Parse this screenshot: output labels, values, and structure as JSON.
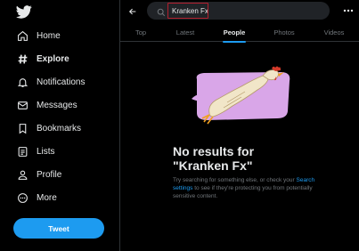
{
  "sidebar": {
    "logo": "bird-icon",
    "items": [
      {
        "label": "Home",
        "icon": "home-icon"
      },
      {
        "label": "Explore",
        "icon": "hashtag-icon",
        "active": true
      },
      {
        "label": "Notifications",
        "icon": "bell-icon"
      },
      {
        "label": "Messages",
        "icon": "envelope-icon"
      },
      {
        "label": "Bookmarks",
        "icon": "bookmark-icon"
      },
      {
        "label": "Lists",
        "icon": "list-icon"
      },
      {
        "label": "Profile",
        "icon": "person-icon"
      },
      {
        "label": "More",
        "icon": "more-circle-icon"
      }
    ],
    "tweet_label": "Tweet"
  },
  "header": {
    "search_value": "Kranken Fx",
    "tabs": [
      "Top",
      "Latest",
      "People",
      "Photos",
      "Videos"
    ],
    "active_tab": "People"
  },
  "results": {
    "title_line1": "No results for",
    "title_line2": "\"Kranken Fx\"",
    "text_before": "Try searching for something else, or check your",
    "link": "Search settings",
    "text_after": "to see if they're protecting you from potentially sensitive content."
  },
  "colors": {
    "accent": "#1d9bf0",
    "background": "#000000",
    "muted_text": "#71767b",
    "illustration_bg": "#d9a6e8"
  }
}
